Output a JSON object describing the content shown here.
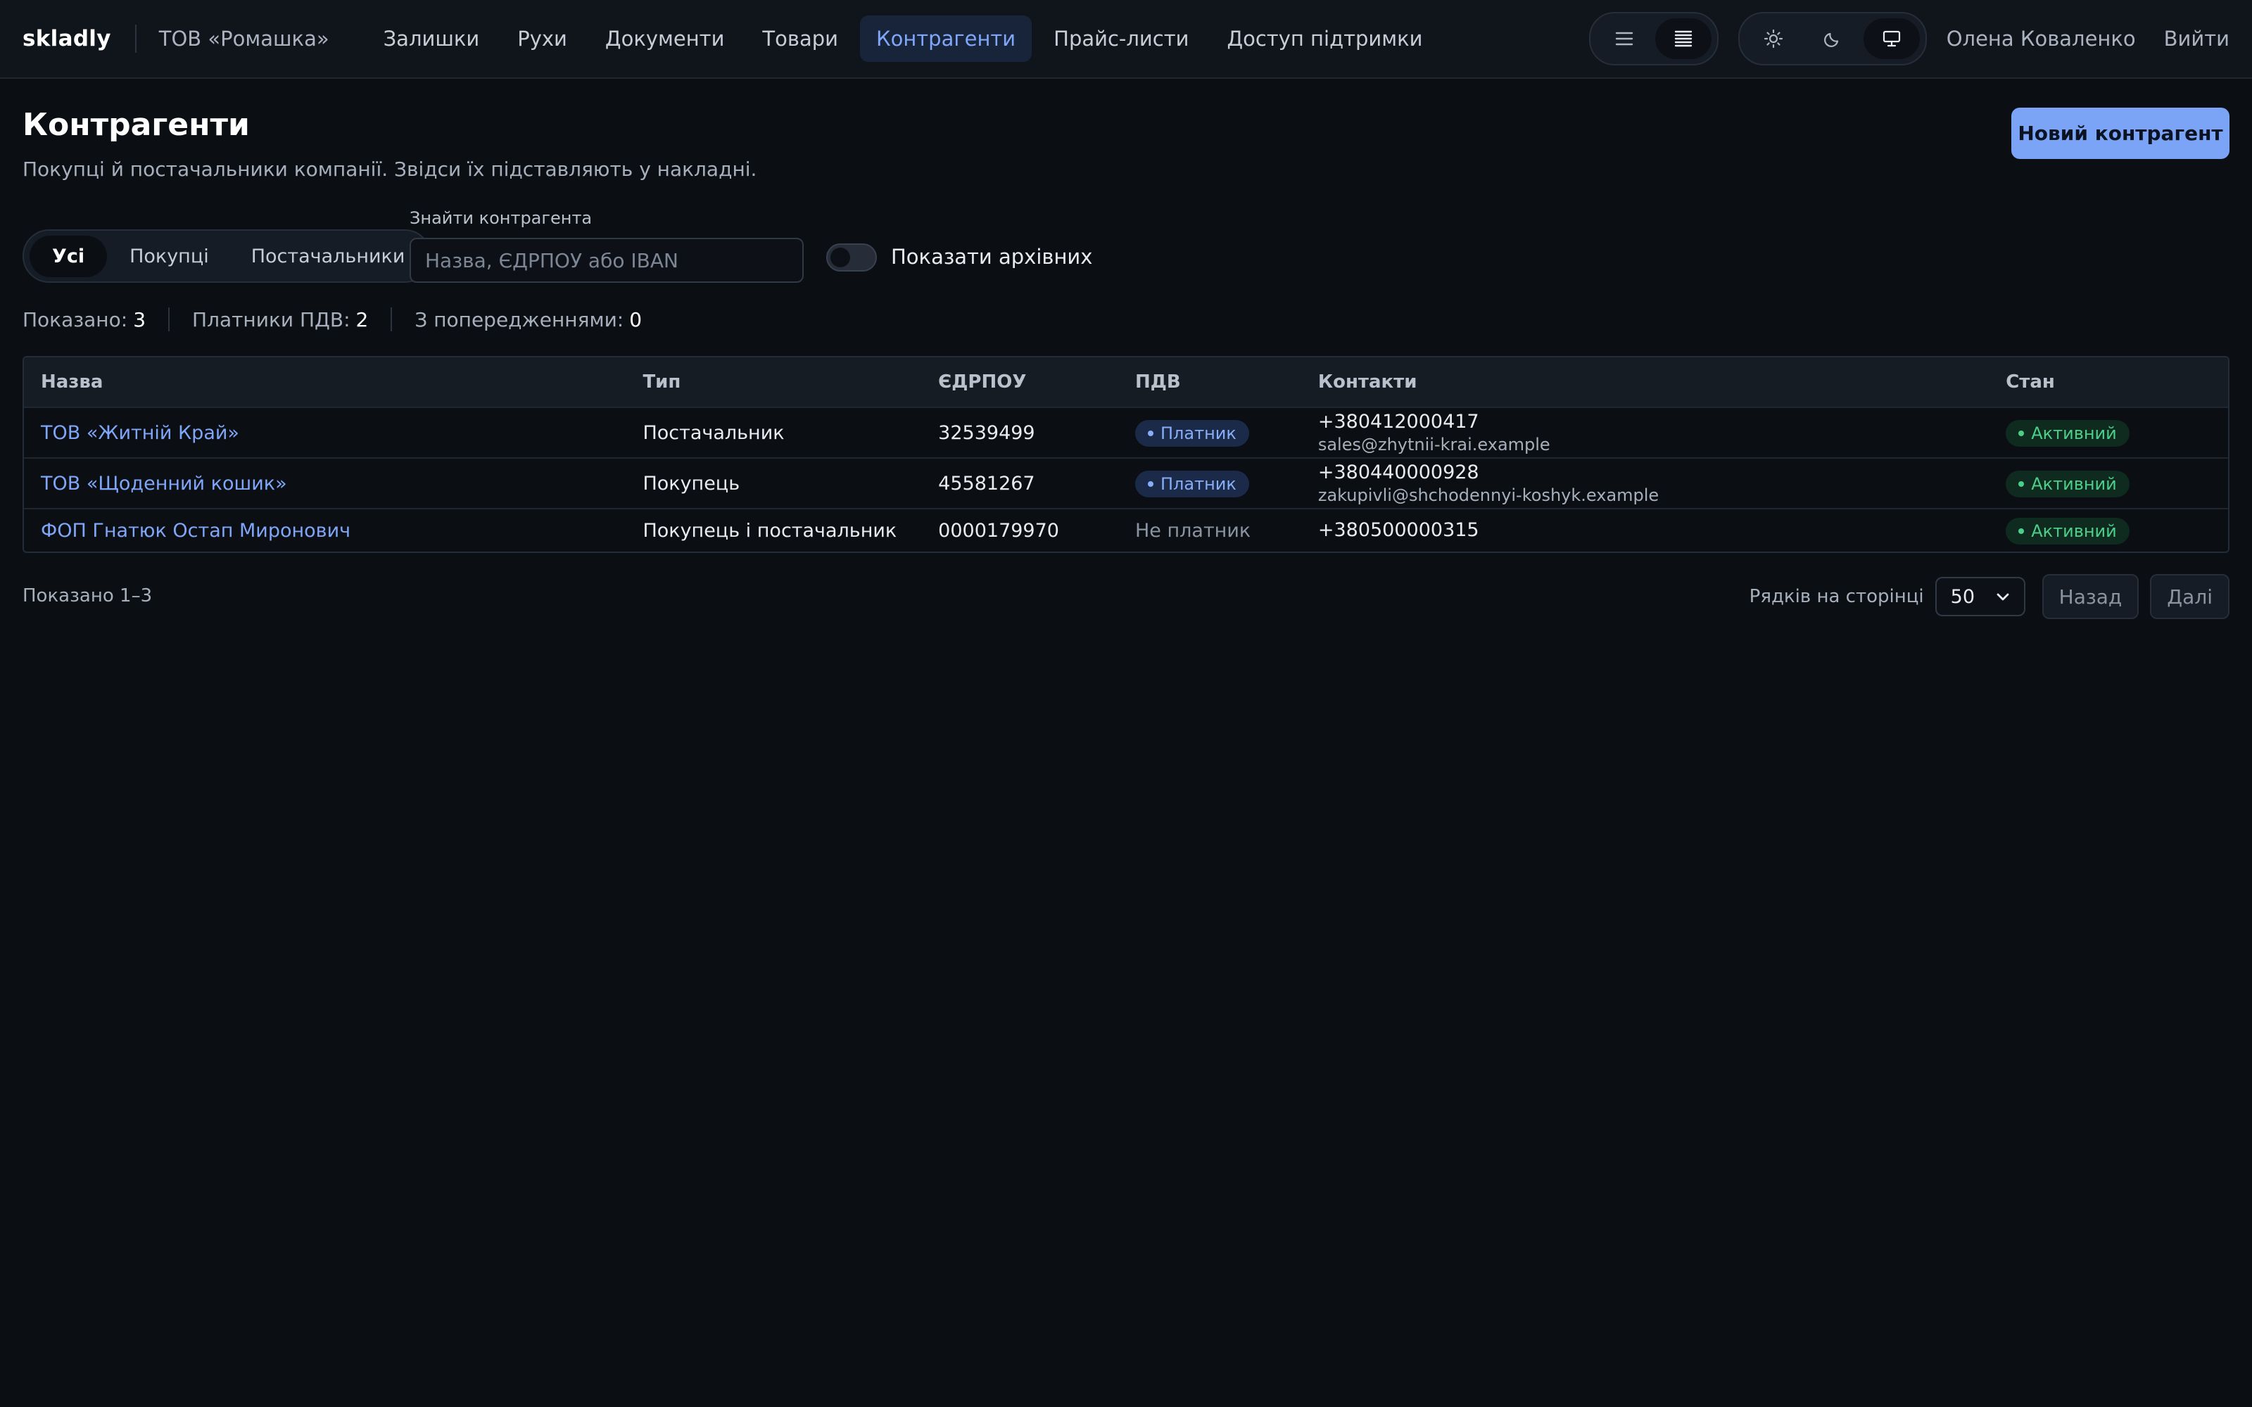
{
  "topbar": {
    "brand": "skladly",
    "company": "ТОВ «Ромашка»",
    "nav": [
      {
        "label": "Залишки"
      },
      {
        "label": "Рухи"
      },
      {
        "label": "Документи"
      },
      {
        "label": "Товари"
      },
      {
        "label": "Контрагенти",
        "active": true
      },
      {
        "label": "Прайс-листи"
      },
      {
        "label": "Доступ підтримки"
      }
    ],
    "density_icons": [
      "list-icon",
      "compact-list-icon"
    ],
    "theme_icons": [
      "sun-icon",
      "moon-icon",
      "monitor-icon"
    ],
    "user_name": "Олена Коваленко",
    "logout_label": "Вийти"
  },
  "header": {
    "title": "Контрагенти",
    "subtitle": "Покупці й постачальники компанії. Звідси їх підставляють у накладні.",
    "new_button_label": "Новий контрагент"
  },
  "filters": {
    "tabs": [
      {
        "label": "Усі",
        "selected": true
      },
      {
        "label": "Покупці"
      },
      {
        "label": "Постачальники"
      }
    ],
    "search_label": "Знайти контрагента",
    "search_placeholder": "Назва, ЄДРПОУ або IBAN",
    "search_value": "",
    "archived_toggle_label": "Показати архівних",
    "archived_toggle_on": false
  },
  "stats": {
    "shown_label": "Показано:",
    "shown_value": "3",
    "vat_label": "Платники ПДВ:",
    "vat_value": "2",
    "warnings_label": "З попередженнями:",
    "warnings_value": "0"
  },
  "table": {
    "columns": {
      "name": "Назва",
      "type": "Тип",
      "code": "ЄДРПОУ",
      "vat": "ПДВ",
      "contacts": "Контакти",
      "state": "Стан"
    },
    "rows": [
      {
        "name": "ТОВ «Житній Край»",
        "type": "Постачальник",
        "code": "32539499",
        "vat": "Платник",
        "phone": "+380412000417",
        "email": "sales@zhytnii-krai.example",
        "state": "Активний"
      },
      {
        "name": "ТОВ «Щоденний кошик»",
        "type": "Покупець",
        "code": "45581267",
        "vat": "Платник",
        "phone": "+380440000928",
        "email": "zakupivli@shchodennyi-koshyk.example",
        "state": "Активний"
      },
      {
        "name": "ФОП Гнатюк Остап Миронович",
        "type": "Покупець і постачальник",
        "code": "0000179970",
        "vat": "Не платник",
        "phone": "+380500000315",
        "email": "",
        "state": "Активний"
      }
    ]
  },
  "footer": {
    "shown_range": "Показано 1–3",
    "per_page_label": "Рядків на сторінці",
    "per_page_value": "50",
    "prev_label": "Назад",
    "next_label": "Далі"
  },
  "colors": {
    "accent": "#7ba4f7",
    "background": "#0b0f14",
    "status_active": "#4ccf8a"
  }
}
